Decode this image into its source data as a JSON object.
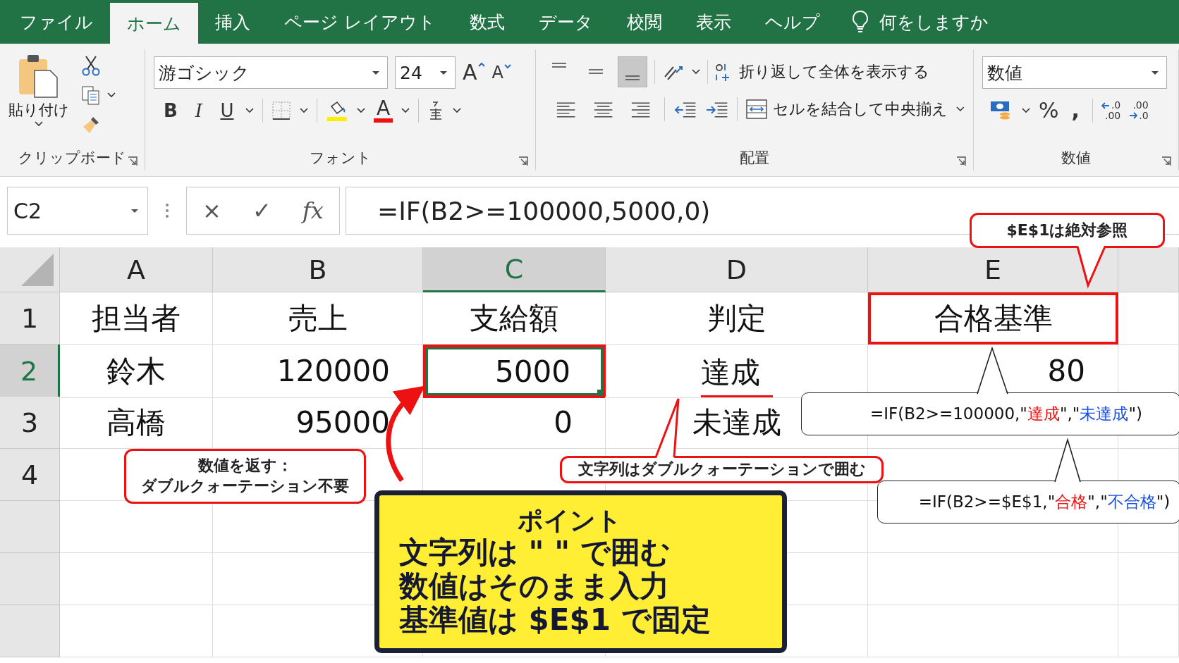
{
  "tabs": [
    {
      "label": "ファイル",
      "selected": false
    },
    {
      "label": "ホーム",
      "selected": true
    },
    {
      "label": "挿入",
      "selected": false
    },
    {
      "label": "ページ レイアウト",
      "selected": false
    },
    {
      "label": "数式",
      "selected": false
    },
    {
      "label": "データ",
      "selected": false
    },
    {
      "label": "校閲",
      "selected": false
    },
    {
      "label": "表示",
      "selected": false
    },
    {
      "label": "ヘルプ",
      "selected": false
    }
  ],
  "search": {
    "placeholder": "何をしますか"
  },
  "clipboard": {
    "paste_label": "貼り付け",
    "group_label": "クリップボード"
  },
  "font": {
    "font_name": "游ゴシック",
    "font_size": "24",
    "grow_label": "A",
    "shrink_label": "A",
    "style_buttons": [
      "B",
      "I",
      "U"
    ],
    "font_color_label": "A",
    "group_label": "フォント"
  },
  "alignment": {
    "vertical_align": [
      {
        "selected": false
      },
      {
        "selected": false
      },
      {
        "selected": true
      }
    ],
    "wrap_label": "折り返して全体を表示する",
    "merge_label": "セルを結合して中央揃え",
    "group_label": "配置"
  },
  "number": {
    "format": "数値",
    "percent_label": "%",
    "comma_label": ",",
    "decimal_buttons": [
      {
        "top": ".0",
        "bottom": ".00"
      },
      {
        "top": ".00",
        "bottom": ".0"
      }
    ],
    "group_label": "数値"
  },
  "formula_bar": {
    "name_box": "C2",
    "cancel": "×",
    "confirm": "✓",
    "function_label": "fx",
    "formula": "=IF(B2>=100000,5000,0)"
  },
  "columns": [
    {
      "label": "A",
      "selected": false
    },
    {
      "label": "B",
      "selected": false
    },
    {
      "label": "C",
      "selected": true
    },
    {
      "label": "D",
      "selected": false
    },
    {
      "label": "E",
      "selected": false
    }
  ],
  "rows": [
    {
      "header": "1",
      "selected": false,
      "cells": [
        {
          "text": "担当者",
          "kind": "text",
          "selected": false,
          "outlined": false,
          "underlined": false
        },
        {
          "text": "売上",
          "kind": "text",
          "selected": false,
          "outlined": false,
          "underlined": false
        },
        {
          "text": "支給額",
          "kind": "text",
          "selected": false,
          "outlined": false,
          "underlined": false
        },
        {
          "text": "判定",
          "kind": "text",
          "selected": false,
          "outlined": false,
          "underlined": false
        },
        {
          "text": "合格基準",
          "kind": "text",
          "selected": false,
          "outlined": true,
          "underlined": false
        }
      ]
    },
    {
      "header": "2",
      "selected": true,
      "cells": [
        {
          "text": "鈴木",
          "kind": "text",
          "selected": false,
          "outlined": false,
          "underlined": false
        },
        {
          "text": "120000",
          "kind": "number",
          "selected": false,
          "outlined": false,
          "underlined": false
        },
        {
          "text": "5000",
          "kind": "number",
          "selected": true,
          "outlined": true,
          "underlined": false
        },
        {
          "text": "達成",
          "kind": "text",
          "selected": false,
          "outlined": false,
          "underlined": true
        },
        {
          "text": "80",
          "kind": "number",
          "selected": false,
          "outlined": false,
          "underlined": false
        }
      ]
    },
    {
      "header": "3",
      "selected": false,
      "cells": [
        {
          "text": "高橋",
          "kind": "text",
          "selected": false,
          "outlined": false,
          "underlined": false
        },
        {
          "text": "95000",
          "kind": "number",
          "selected": false,
          "outlined": false,
          "underlined": false
        },
        {
          "text": "0",
          "kind": "number",
          "selected": false,
          "outlined": false,
          "underlined": false
        },
        {
          "text": "未達成",
          "kind": "text",
          "selected": false,
          "outlined": false,
          "underlined": false
        }
      ]
    },
    {
      "header": "4",
      "selected": false
    }
  ],
  "annotations": [
    {
      "kind": "note",
      "lines": [
        "$E$1は絶対参照"
      ]
    },
    {
      "kind": "formula",
      "segments": [
        {
          "text": "=IF(B2>=100000,\"",
          "color": "#111111"
        },
        {
          "text": "達成",
          "color": "#ee1111"
        },
        {
          "text": "\",\"",
          "color": "#111111"
        },
        {
          "text": "未達成",
          "color": "#1a4fe0"
        },
        {
          "text": "\")",
          "color": "#111111"
        }
      ]
    },
    {
      "kind": "note",
      "lines": [
        "数値を返す：",
        "ダブルクォーテーション不要"
      ]
    },
    {
      "kind": "note",
      "lines": [
        "文字列はダブルクォーテーションで囲む"
      ]
    },
    {
      "kind": "formula",
      "segments": [
        {
          "text": "=IF(B2>=$E$1,\"",
          "color": "#111111"
        },
        {
          "text": "合格",
          "color": "#ee1111"
        },
        {
          "text": "\",\"",
          "color": "#111111"
        },
        {
          "text": "不合格",
          "color": "#1a4fe0"
        },
        {
          "text": "\")",
          "color": "#111111"
        }
      ]
    },
    {
      "kind": "summary",
      "title": "ポイント",
      "lines": [
        "文字列は \" \" で囲む",
        "数値はそのまま入力",
        "基準値は $E$1 で固定"
      ]
    }
  ]
}
